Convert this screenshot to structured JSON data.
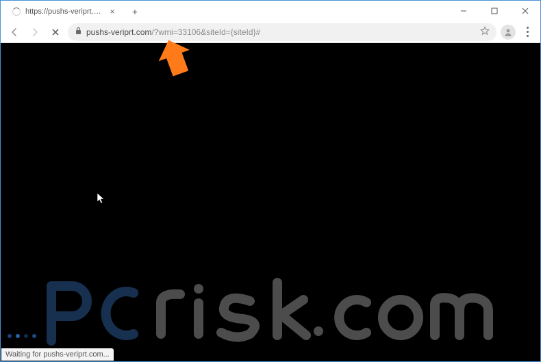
{
  "tab": {
    "title": "https://pushs-veriprt.com/?wmi=",
    "close_symbol": "×"
  },
  "newtab_symbol": "+",
  "window_controls": {
    "minimize": "–",
    "maximize": "☐",
    "close": "×"
  },
  "toolbar": {
    "back": "←",
    "forward": "→",
    "stop": "×"
  },
  "omnibox": {
    "lock": "🔒",
    "host": "pushs-veriprt.com",
    "path": "/?wmi=33106&siteId={siteId}#",
    "star": "☆"
  },
  "statusbar": {
    "text": "Waiting for pushs-veriprt.com..."
  },
  "watermark": {
    "text": "pcrisk.com",
    "highlight": "pc"
  }
}
